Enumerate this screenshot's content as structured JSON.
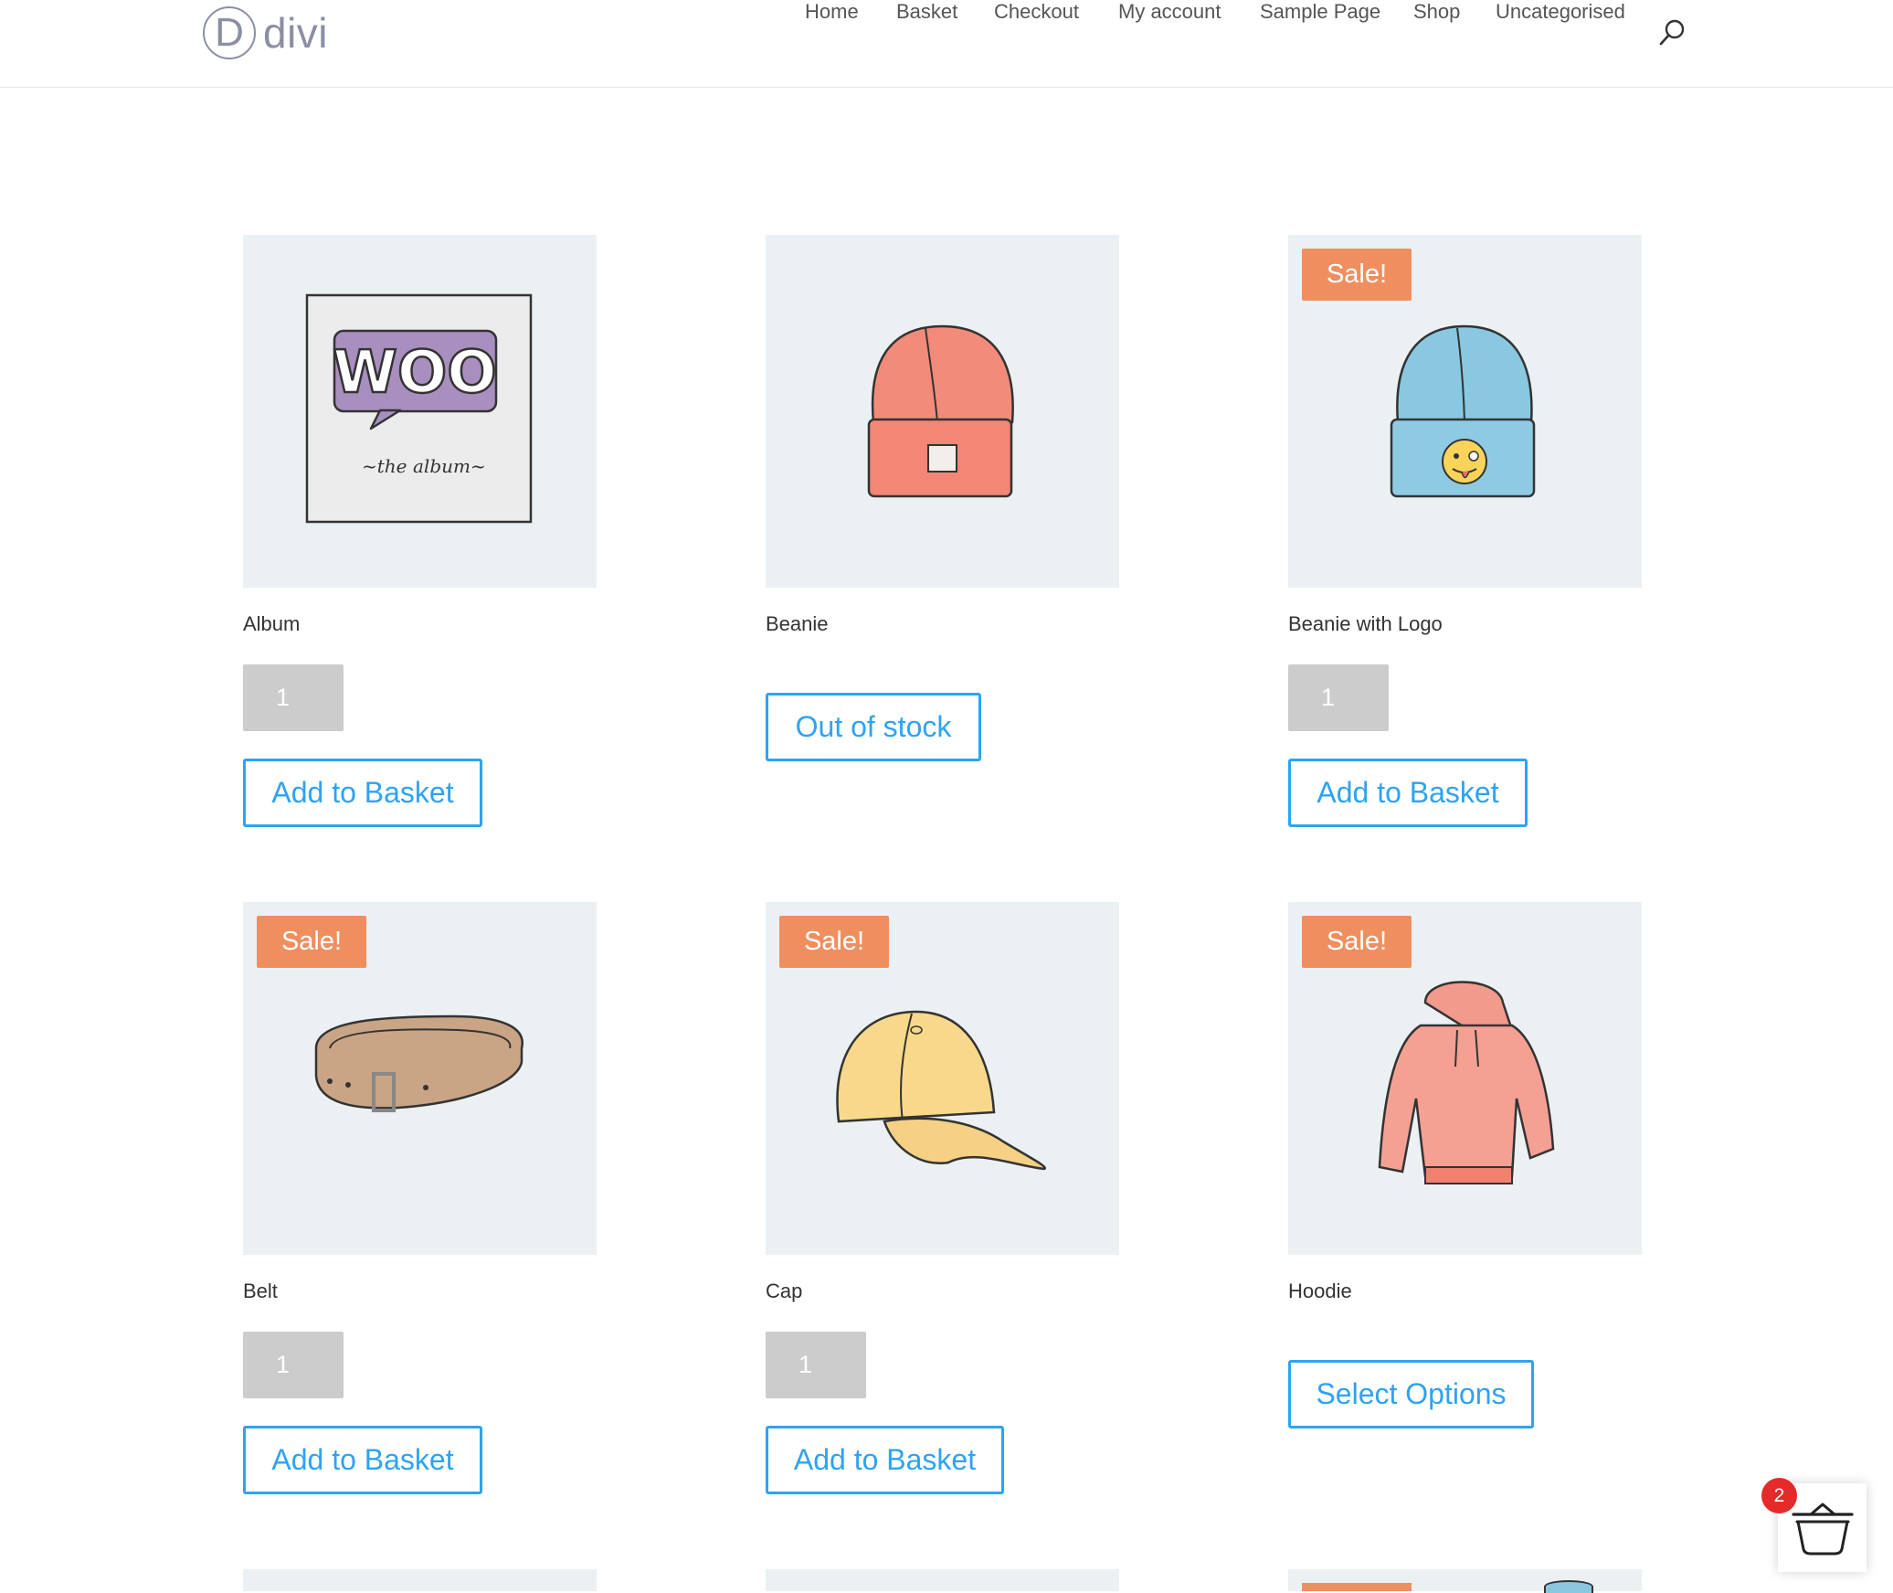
{
  "header": {
    "logo_letter": "D",
    "logo_text": "divi",
    "nav": [
      "Home",
      "Basket",
      "Checkout",
      "My account",
      "Sample Page",
      "Shop",
      "Uncategorised"
    ]
  },
  "products": [
    {
      "title": "Album",
      "sale": false,
      "qty": "1",
      "button": "Add to Basket",
      "icon": "album-icon"
    },
    {
      "title": "Beanie",
      "sale": false,
      "button": "Out of stock",
      "icon": "beanie-icon"
    },
    {
      "title": "Beanie with Logo",
      "sale": true,
      "sale_label": "Sale!",
      "qty": "1",
      "button": "Add to Basket",
      "icon": "beanie-with-logo-icon"
    },
    {
      "title": "Belt",
      "sale": true,
      "sale_label": "Sale!",
      "qty": "1",
      "button": "Add to Basket",
      "icon": "belt-icon"
    },
    {
      "title": "Cap",
      "sale": true,
      "sale_label": "Sale!",
      "qty": "1",
      "button": "Add to Basket",
      "icon": "cap-icon"
    },
    {
      "title": "Hoodie",
      "sale": true,
      "sale_label": "Sale!",
      "button": "Select Options",
      "icon": "hoodie-icon"
    }
  ],
  "mini_cart": {
    "count": "2",
    "icon": "basket-icon"
  },
  "colors": {
    "accent": "#2ea3f2",
    "sale": "#ef8f5f",
    "image_bg": "#ebf0f3",
    "qty_bg": "#cccccc",
    "cart_badge": "#e52a2a"
  }
}
